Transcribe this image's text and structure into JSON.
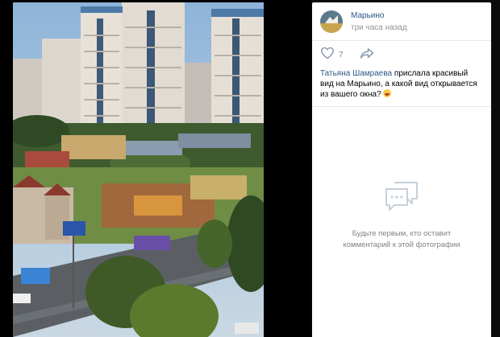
{
  "post": {
    "author_name": "Марьино",
    "time": "три часа назад",
    "likes": "7",
    "caption_mention": "Татьяна Шамраева",
    "caption_text": " прислала красивый вид на Марьино, а какой вид открывается из вашего окна? "
  },
  "comments": {
    "empty_line1": "Будьте первым, кто оставит",
    "empty_line2": "комментарий к этой фотографии"
  },
  "icons": {
    "like": "heart-icon",
    "share": "share-arrow-icon",
    "comments": "comment-bubble-icon",
    "emoji": "grinning-face-emoji"
  },
  "colors": {
    "link": "#2a5885",
    "muted": "#828282",
    "background": "#0b0b0b"
  }
}
